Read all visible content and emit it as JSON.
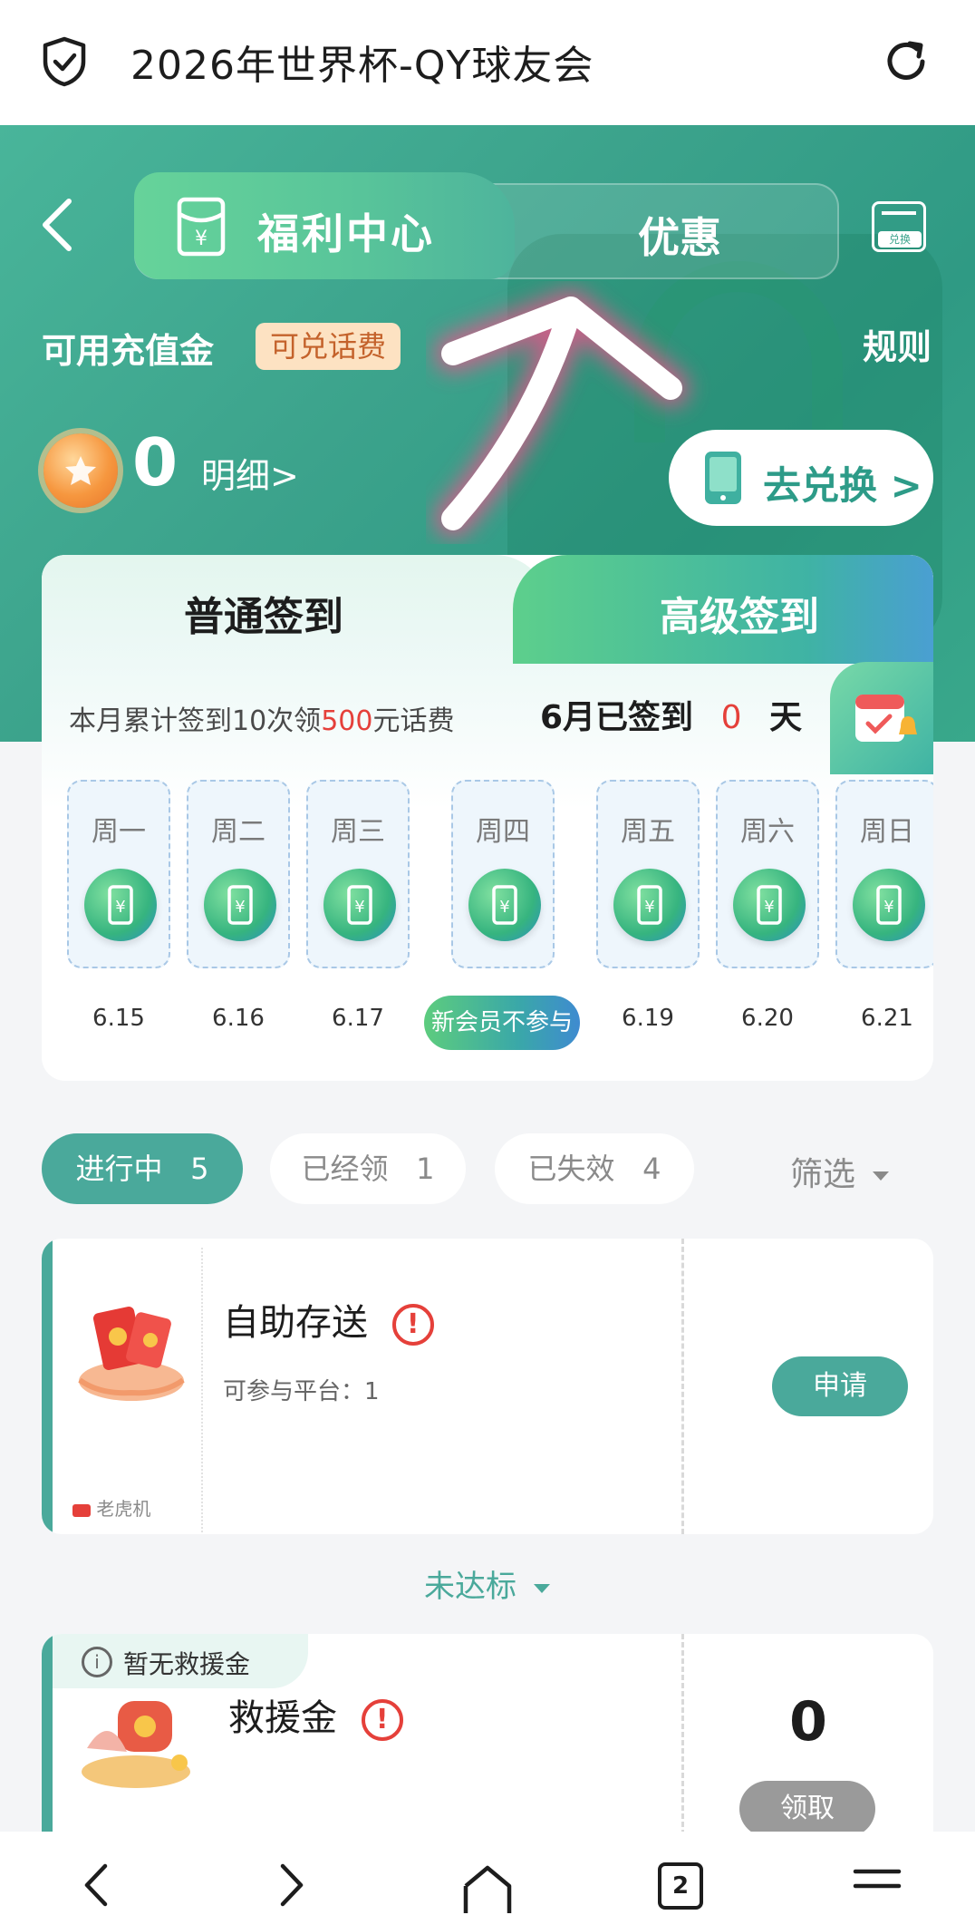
{
  "browser": {
    "title": "2026年世界杯-QY球友会",
    "tab_count": "2"
  },
  "hero": {
    "tab_active": "福利中心",
    "tab_inactive": "优惠",
    "exchange_icon_label": "兑换",
    "balance_label": "可用充值金",
    "balance_tag": "可兑话费",
    "rules": "规则",
    "balance_value": "0",
    "details": "明细>",
    "exchange_button": "去兑换 >"
  },
  "signin": {
    "tab_normal": "普通签到",
    "tab_advanced": "高级签到",
    "promo_prefix": "本月累计签到10次领",
    "promo_amount": "500",
    "promo_suffix": "元话费",
    "status_prefix": "6月已签到",
    "status_days": "0",
    "status_suffix": "天",
    "days": [
      {
        "label": "周一",
        "date": "6.15"
      },
      {
        "label": "周二",
        "date": "6.16"
      },
      {
        "label": "周三",
        "date": "6.17"
      },
      {
        "label": "周四",
        "date": "新会员不参与"
      },
      {
        "label": "周五",
        "date": "6.19"
      },
      {
        "label": "周六",
        "date": "6.20"
      },
      {
        "label": "周日",
        "date": "6.21"
      }
    ]
  },
  "filters": {
    "in_progress": "进行中",
    "in_progress_count": "5",
    "claimed": "已经领",
    "claimed_count": "1",
    "expired": "已失效",
    "expired_count": "4",
    "filter": "筛选"
  },
  "promos": [
    {
      "title": "自助存送",
      "sub": "可参与平台：1",
      "badge": "老虎机",
      "action": "申请"
    },
    {
      "title": "救援金",
      "notice": "暂无救援金",
      "amount": "0",
      "action": "领取"
    }
  ],
  "not_reached": "未达标",
  "colors": {
    "accent": "#4aa99b",
    "warn": "#e5403a",
    "tag_bg": "#fde2c2"
  }
}
